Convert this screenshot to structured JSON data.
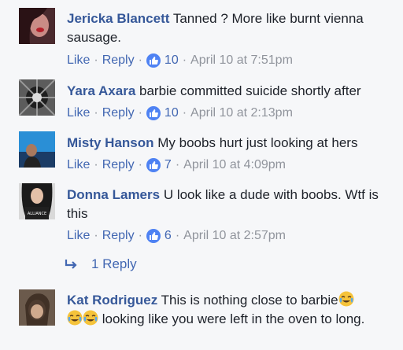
{
  "comments": [
    {
      "author": "Jericka Blancett",
      "text": "Tanned ? More like burnt vienna sausage.",
      "like_label": "Like",
      "reply_label": "Reply",
      "sep": "·",
      "likes": "10",
      "time": "April 10 at 7:51pm"
    },
    {
      "author": "Yara Axara",
      "text": "barbie committed suicide shortly after",
      "like_label": "Like",
      "reply_label": "Reply",
      "sep": "·",
      "likes": "10",
      "time": "April 10 at 2:13pm"
    },
    {
      "author": "Misty Hanson",
      "text": "My boobs hurt just looking at hers",
      "like_label": "Like",
      "reply_label": "Reply",
      "sep": "·",
      "likes": "7",
      "time": "April 10 at 4:09pm"
    },
    {
      "author": "Donna Lamers",
      "text": "U look like a dude with boobs. Wtf is this",
      "like_label": "Like",
      "reply_label": "Reply",
      "sep": "·",
      "likes": "6",
      "time": "April 10 at 2:57pm",
      "replies_label": "1 Reply"
    },
    {
      "author": "Kat Rodriguez",
      "text_part1": "This is nothing close to barbie",
      "text_part2": "looking like you were left in the oven to long."
    }
  ],
  "colors": {
    "author": "#365899",
    "link": "#4267b2",
    "meta": "#90949c",
    "like_badge": "#4e82f3",
    "background": "#f6f7f9"
  },
  "icons": [
    "like-thumb-icon",
    "reply-arrow-icon",
    "crying-laughing-emoji-icon"
  ]
}
